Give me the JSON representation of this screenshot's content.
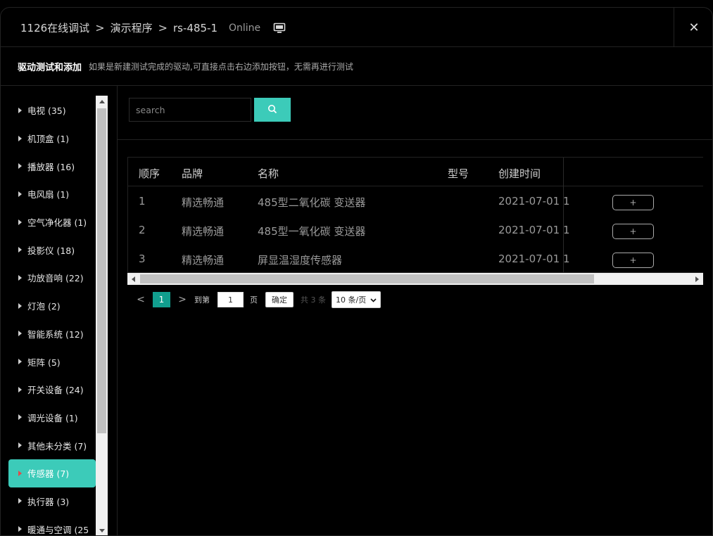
{
  "header": {
    "breadcrumb": [
      "1126在线调试",
      "演示程序",
      "rs-485-1"
    ],
    "separator": ">",
    "status": "Online",
    "close_label": "✕"
  },
  "subheader": {
    "title": "驱动测试和添加",
    "hint": "如果是新建测试完成的驱动,可直接点击右边添加按钮，无需再进行测试"
  },
  "sidebar": {
    "items": [
      {
        "label": "电视 (35)"
      },
      {
        "label": "机顶盒 (1)"
      },
      {
        "label": "播放器 (16)"
      },
      {
        "label": "电风扇 (1)"
      },
      {
        "label": "空气净化器 (1)"
      },
      {
        "label": "投影仪 (18)"
      },
      {
        "label": "功放音响 (22)"
      },
      {
        "label": "灯泡 (2)"
      },
      {
        "label": "智能系统 (12)"
      },
      {
        "label": "矩阵 (5)"
      },
      {
        "label": "开关设备 (24)"
      },
      {
        "label": "调光设备 (1)"
      },
      {
        "label": "其他未分类 (7)"
      },
      {
        "label": "传感器 (7)"
      },
      {
        "label": "执行器 (3)"
      },
      {
        "label": "暖通与空调 (25"
      }
    ],
    "active_index": 13
  },
  "search": {
    "placeholder": "search"
  },
  "table": {
    "columns": [
      "顺序",
      "品牌",
      "名称",
      "型号",
      "创建时间"
    ],
    "rows": [
      {
        "index": "1",
        "brand": "精选畅通",
        "name": "485型二氧化碳 变送器",
        "model": "",
        "created": "2021-07-01 1"
      },
      {
        "index": "2",
        "brand": "精选畅通",
        "name": "485型一氧化碳 变送器",
        "model": "",
        "created": "2021-07-01 1"
      },
      {
        "index": "3",
        "brand": "精选畅通",
        "name": "屏显温湿度传感器",
        "model": "",
        "created": "2021-07-01 1"
      }
    ],
    "add_label": "+"
  },
  "pager": {
    "prev": "<",
    "current_page": "1",
    "next": ">",
    "goto_label": "到第",
    "goto_value": "1",
    "page_unit": "页",
    "confirm_label": "确定",
    "total_label": "共 3 条",
    "page_size": "10 条/页"
  },
  "colors": {
    "accent": "#3ccbb9",
    "page_active": "#119e8e",
    "active_marker": "#e24a4a"
  }
}
